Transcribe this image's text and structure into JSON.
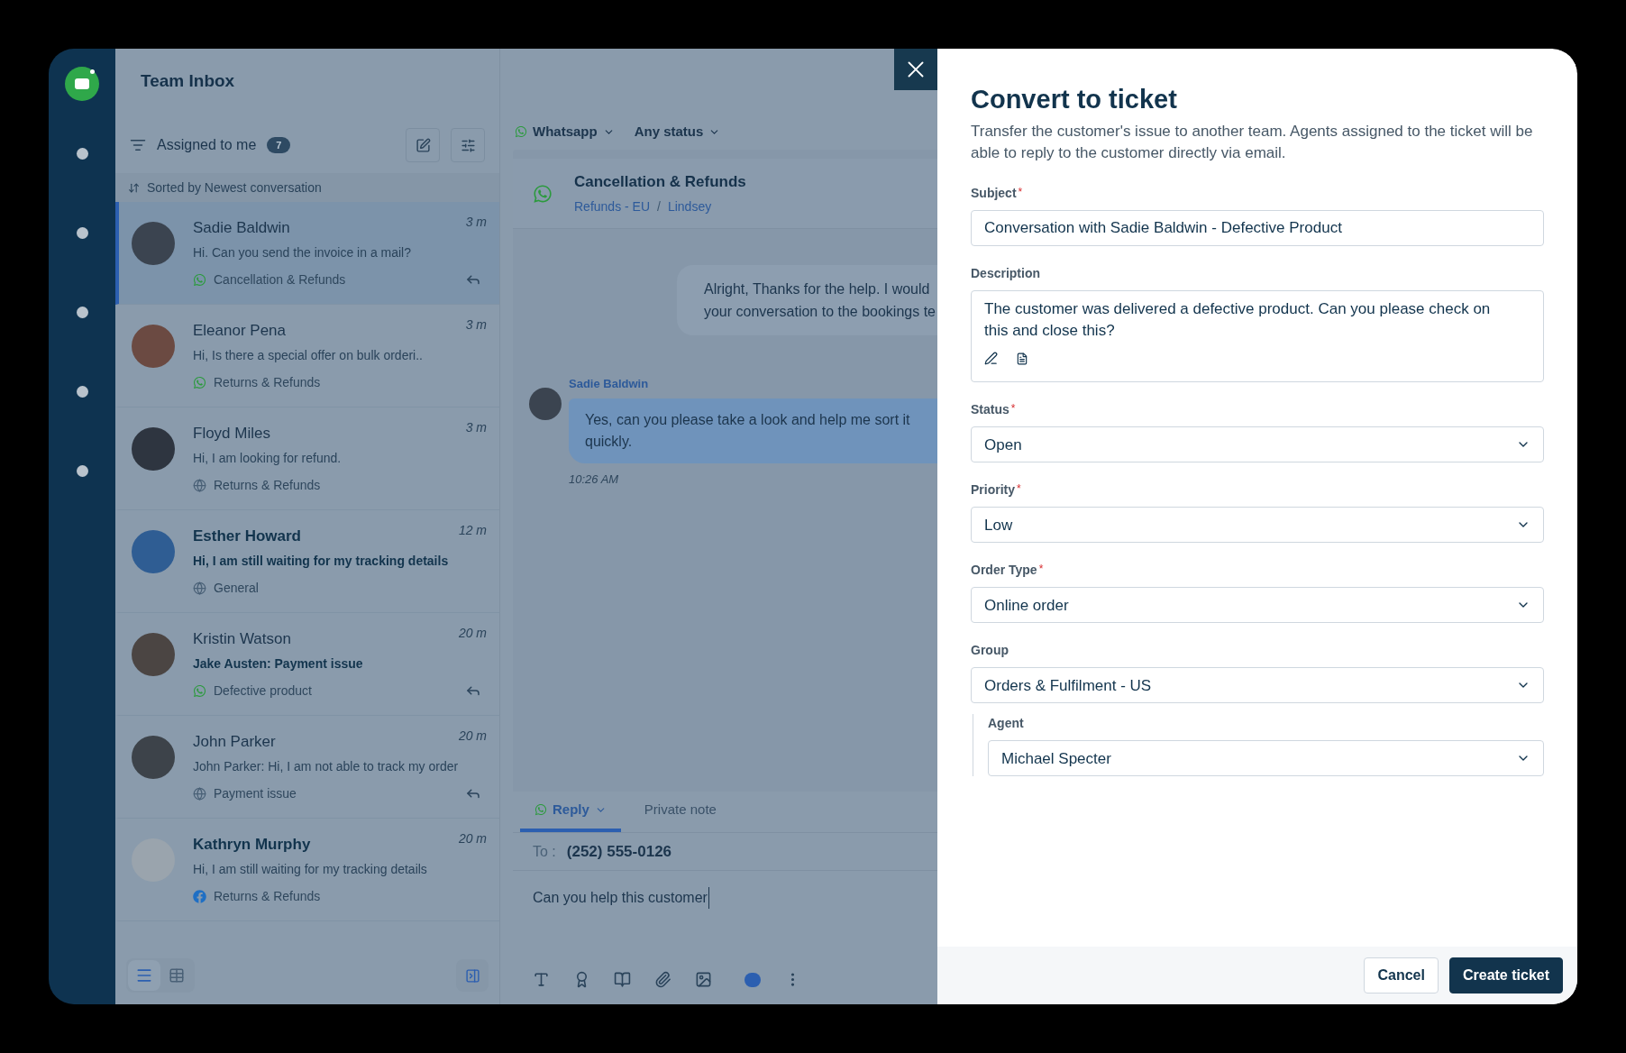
{
  "app": {
    "title": "Team Inbox"
  },
  "list_header": {
    "view": "Assigned to me",
    "count": "7",
    "sort": "Sorted by Newest conversation"
  },
  "conversations": [
    {
      "name": "Sadie Baldwin",
      "time": "3 m",
      "preview": "Hi. Can you send the invoice in a mail?",
      "kind": "whatsapp",
      "tag": "Cancellation & Refunds",
      "name_bold": false,
      "preview_bold": false,
      "replied": true,
      "selected": true
    },
    {
      "name": "Eleanor Pena",
      "time": "3 m",
      "preview": "Hi, Is there a special offer on bulk orderi..",
      "kind": "whatsapp",
      "tag": "Returns & Refunds",
      "name_bold": false,
      "preview_bold": false,
      "replied": false,
      "selected": false
    },
    {
      "name": "Floyd Miles",
      "time": "3 m",
      "preview": "Hi, I am looking for refund.",
      "kind": "web",
      "tag": "Returns & Refunds",
      "name_bold": false,
      "preview_bold": false,
      "replied": false,
      "selected": false
    },
    {
      "name": "Esther Howard",
      "time": "12 m",
      "preview": "Hi, I am still waiting for my tracking details",
      "kind": "web",
      "tag": "General",
      "name_bold": true,
      "preview_bold": true,
      "replied": false,
      "selected": false
    },
    {
      "name": "Kristin Watson",
      "time": "20 m",
      "preview": "Jake Austen: Payment issue",
      "kind": "whatsapp",
      "tag": "Defective product",
      "name_bold": false,
      "preview_bold": true,
      "replied": true,
      "selected": false
    },
    {
      "name": "John Parker",
      "time": "20 m",
      "preview": "John Parker: Hi, I am not able to track my order",
      "kind": "web",
      "tag": "Payment issue",
      "name_bold": false,
      "preview_bold": false,
      "replied": true,
      "selected": false
    },
    {
      "name": "Kathryn Murphy",
      "time": "20 m",
      "preview": "Hi, I am still waiting for my tracking details",
      "kind": "facebook",
      "tag": "Returns & Refunds",
      "name_bold": true,
      "preview_bold": false,
      "replied": false,
      "selected": false
    }
  ],
  "view_toggle": [
    {
      "kind": "list",
      "selected": true
    },
    {
      "kind": "table",
      "selected": false
    }
  ],
  "filters": [
    {
      "label": "Whatsapp",
      "kind": "whatsapp"
    },
    {
      "label": "Any status",
      "kind": "plain"
    }
  ],
  "conversation": {
    "title": "Cancellation & Refunds",
    "kind": "whatsapp",
    "breadcrumbs": [
      "Refunds - EU",
      "Lindsey"
    ],
    "separator": "/"
  },
  "messages": [
    {
      "kind": "outgoing",
      "lines": [
        "Alright, Thanks for the help. I would",
        "your conversation to the bookings te"
      ]
    },
    {
      "kind": "incoming",
      "sender": "Sadie Baldwin",
      "lines": [
        "Yes, can you please take a look and help me sort it",
        "quickly."
      ],
      "time": "10:26 AM"
    }
  ],
  "composer": {
    "tabs": [
      {
        "label": "Reply",
        "selected": true
      },
      {
        "label": "Private note",
        "selected": false
      }
    ],
    "to_label": "To :",
    "to": "(252) 555-0126",
    "value": "Can you help this customer"
  },
  "dialog": {
    "title": "Convert to ticket",
    "description": "Transfer the customer's issue to another team. Agents assigned to the ticket will be able to reply to the customer directly via email.",
    "fields": [
      {
        "kind": "text",
        "label": "Subject",
        "required_mark": "*",
        "value": "Conversation with Sadie Baldwin - Defective Product"
      },
      {
        "kind": "textarea",
        "label": "Description",
        "value": "The customer was delivered a defective product. Can you please check on this and close this?"
      },
      {
        "kind": "select",
        "label": "Status",
        "required_mark": "*",
        "value": "Open"
      },
      {
        "kind": "select",
        "label": "Priority",
        "required_mark": "*",
        "value": "Low"
      },
      {
        "kind": "select",
        "label": "Order Type",
        "required_mark": "*",
        "value": "Online order"
      },
      {
        "kind": "select",
        "label": "Group",
        "value": "Orders & Fulfilment - US",
        "children": [
          {
            "kind": "select",
            "label": "Agent",
            "value": "Michael Specter"
          }
        ]
      }
    ],
    "buttons": [
      {
        "label": "Cancel",
        "kind": "secondary"
      },
      {
        "label": "Create ticket",
        "kind": "primary"
      }
    ]
  }
}
